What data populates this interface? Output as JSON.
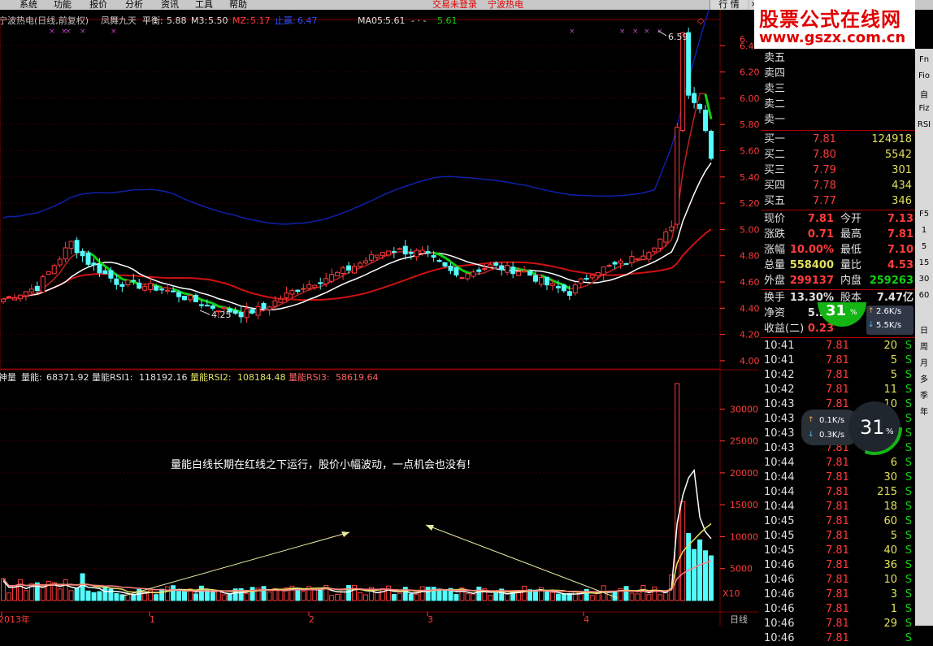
{
  "menu": {
    "items": [
      "系统",
      "功能",
      "报价",
      "分析",
      "资讯",
      "工具",
      "帮助"
    ],
    "status_left": "交易未登录",
    "status_right": "宁波热电",
    "quote_button": "行 情",
    "close_label": "×"
  },
  "watermark": {
    "line1": "股票公式在线网",
    "line2": "www.gszx.com.cn"
  },
  "main_legend": {
    "name": "宁波热电(日线,前复权)",
    "indicator": "凤舞九天",
    "balance_label": "平衡:",
    "balance_value": "5.88",
    "m3_label": "M3:",
    "m3_value": "5.50",
    "mz_label": "MZ:",
    "mz_value": "5.17",
    "stop_label": "止赢:",
    "stop_value": "6.47",
    "ma05_label": "MA05:",
    "ma05_value": "5.61",
    "dash": "- · -",
    "ma05_value2": "5.61",
    "corner": "◇"
  },
  "sub_legend": {
    "name": "神量",
    "vol_label": "量能:",
    "vol_value": "68371.92",
    "rsi1_label": "量能RSI1:",
    "rsi1_value": "118192.16",
    "rsi2_label": "量能RSI2:",
    "rsi2_value": "108184.48",
    "rsi3_label": "量能RSI3:",
    "rsi3_value": "58619.64"
  },
  "annotation": "量能白线长期在红线之下运行，股价小幅波动，一点机会也没有!",
  "x10": "X10",
  "price_axis": [
    "6.40",
    "6.20",
    "6.00",
    "5.80",
    "5.60",
    "5.40",
    "5.20",
    "5.00",
    "4.80",
    "4.60",
    "4.40",
    "4.20",
    "4.00"
  ],
  "price_axis_top": "6.",
  "vol_axis": [
    "30000",
    "25000",
    "20000",
    "15000",
    "10000",
    "5000"
  ],
  "date_axis": {
    "year": "2013年",
    "months": [
      "1",
      "2",
      "3",
      "4"
    ],
    "period": "日线"
  },
  "extremes": {
    "high": "6.59",
    "low": "4.25"
  },
  "quote": {
    "sell": [
      {
        "label": "卖五"
      },
      {
        "label": "卖四"
      },
      {
        "label": "卖三"
      },
      {
        "label": "卖二"
      },
      {
        "label": "卖一"
      }
    ],
    "buy": [
      {
        "label": "买一",
        "price": "7.81",
        "vol": "124918"
      },
      {
        "label": "买二",
        "price": "7.80",
        "vol": "5542"
      },
      {
        "label": "买三",
        "price": "7.79",
        "vol": "301"
      },
      {
        "label": "买四",
        "price": "7.78",
        "vol": "434"
      },
      {
        "label": "买五",
        "price": "7.77",
        "vol": "346"
      }
    ],
    "stats": [
      {
        "l1": "现价",
        "v1": "7.81",
        "l2": "今开",
        "v2": "7.13"
      },
      {
        "l1": "涨跌",
        "v1": "0.71",
        "l2": "最高",
        "v2": "7.81"
      },
      {
        "l1": "涨幅",
        "v1": "10.00%",
        "l2": "最低",
        "v2": "7.10"
      },
      {
        "l1": "总量",
        "v1": "558400",
        "l2": "量比",
        "v2": "4.53"
      },
      {
        "l1": "外盘",
        "v1": "299137",
        "l2": "内盘",
        "v2": "259263"
      },
      {
        "l1": "换手",
        "v1": "13.30%",
        "l2": "股本",
        "v2": "7.47亿"
      },
      {
        "l1": "净资",
        "v1": "5.25",
        "l2": "流通",
        "v2": "4.20亿"
      },
      {
        "l1": "收益(二)",
        "v1": "0.23",
        "l2": "",
        "v2": "10.1"
      }
    ],
    "ticks": [
      {
        "t": "10:41",
        "p": "7.81",
        "v": "20",
        "s": "S"
      },
      {
        "t": "10:41",
        "p": "7.81",
        "v": "5",
        "s": "S"
      },
      {
        "t": "10:42",
        "p": "7.81",
        "v": "5",
        "s": "S"
      },
      {
        "t": "10:42",
        "p": "7.81",
        "v": "11",
        "s": "S"
      },
      {
        "t": "10:43",
        "p": "7.81",
        "v": "10",
        "s": "S"
      },
      {
        "t": "10:43",
        "p": "7.81",
        "v": "",
        "s": "S"
      },
      {
        "t": "10:43",
        "p": "7.81",
        "v": "",
        "s": "S"
      },
      {
        "t": "10:43",
        "p": "7.81",
        "v": "",
        "s": "S"
      },
      {
        "t": "10:44",
        "p": "7.81",
        "v": "6",
        "s": "S"
      },
      {
        "t": "10:44",
        "p": "7.81",
        "v": "30",
        "s": "S"
      },
      {
        "t": "10:44",
        "p": "7.81",
        "v": "215",
        "s": "S"
      },
      {
        "t": "10:44",
        "p": "7.81",
        "v": "18",
        "s": "S"
      },
      {
        "t": "10:45",
        "p": "7.81",
        "v": "60",
        "s": "S"
      },
      {
        "t": "10:45",
        "p": "7.81",
        "v": "5",
        "s": "S"
      },
      {
        "t": "10:45",
        "p": "7.81",
        "v": "40",
        "s": "S"
      },
      {
        "t": "10:46",
        "p": "7.81",
        "v": "36",
        "s": "S"
      },
      {
        "t": "10:46",
        "p": "7.81",
        "v": "10",
        "s": "S"
      },
      {
        "t": "10:46",
        "p": "7.81",
        "v": "3",
        "s": "S"
      },
      {
        "t": "10:46",
        "p": "7.81",
        "v": "1",
        "s": "S"
      },
      {
        "t": "10:46",
        "p": "7.81",
        "v": "29",
        "s": "S"
      },
      {
        "t": "10:46",
        "p": "7.81",
        "v": "",
        "s": "S"
      }
    ]
  },
  "speed_widget_1": {
    "percent": "31",
    "unit": "%",
    "up": "2.6K/s",
    "down": "5.5K/s"
  },
  "speed_widget_2": {
    "percent": "31",
    "unit": "%",
    "up": "0.1K/s",
    "down": "0.3K/s"
  },
  "right_tools": [
    "Fn",
    "Fio",
    "自",
    "Fiz",
    "RSI",
    "F5",
    "1",
    "5",
    "15",
    "30",
    "60",
    "日",
    "周",
    "月",
    "多",
    "季",
    "年"
  ],
  "colors": {
    "up": "#ff3c3c",
    "down": "#54fcfc",
    "white": "#ffffff",
    "red": "#d01010",
    "blue": "#1020a8",
    "green": "#10d010",
    "yellow": "#e8e060",
    "grid": "#800000"
  }
}
